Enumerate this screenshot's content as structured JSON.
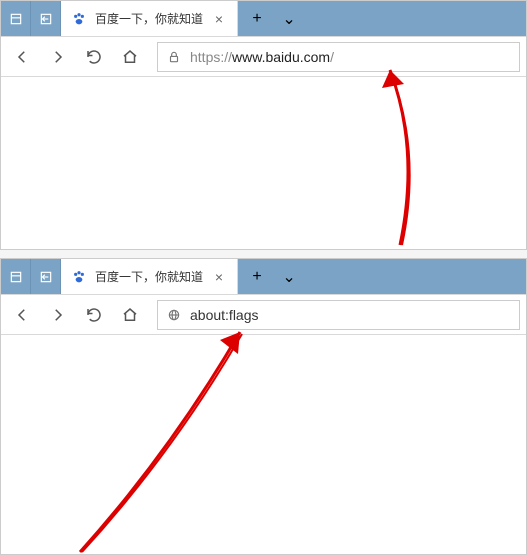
{
  "snap1": {
    "tab_title": "百度一下，你就知道",
    "favicon_color": "#2f6bd8",
    "url": {
      "proto": "https://",
      "host": "www.baidu.com",
      "path": "/"
    }
  },
  "snap2": {
    "tab_title": "百度一下，你就知道",
    "favicon_color": "#2f6bd8",
    "url": {
      "text": "about:flags"
    }
  },
  "icons": {
    "close": "×",
    "plus": "+",
    "chevron": "⌄"
  }
}
